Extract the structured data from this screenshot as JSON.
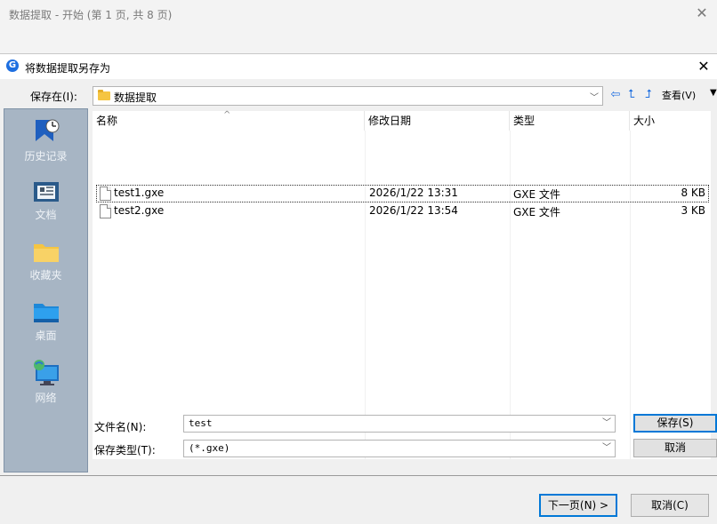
{
  "wizard": {
    "title": "数据提取 - 开始  (第 1 页, 共 8 页)",
    "next_button": "下一页(N) >",
    "cancel_button": "取消(C)"
  },
  "dialog": {
    "title": "将数据提取另存为",
    "save_in_label": "保存在(I):",
    "save_in_value": "数据提取",
    "view_menu": "查看(V)",
    "places": [
      {
        "label": "历史记录",
        "icon": "history-icon"
      },
      {
        "label": "文档",
        "icon": "documents-icon"
      },
      {
        "label": "收藏夹",
        "icon": "favorites-folder-icon"
      },
      {
        "label": "桌面",
        "icon": "desktop-icon"
      },
      {
        "label": "网络",
        "icon": "network-icon"
      }
    ],
    "columns": [
      "名称",
      "修改日期",
      "类型",
      "大小"
    ],
    "files": [
      {
        "name": "test1.gxe",
        "modified": "2026/1/22 13:31",
        "type": "GXE 文件",
        "size": "8 KB"
      },
      {
        "name": "test2.gxe",
        "modified": "2026/1/22 13:54",
        "type": "GXE 文件",
        "size": "3 KB"
      }
    ],
    "filename_label": "文件名(N):",
    "filename_value": "test",
    "filetype_label": "保存类型(T):",
    "filetype_value": "(*.gxe)",
    "save_button": "保存(S)",
    "cancel_button": "取消"
  },
  "colors": {
    "places_bg": "#a7b5c4",
    "accent": "#0078d7",
    "folder": "#f5c542"
  }
}
